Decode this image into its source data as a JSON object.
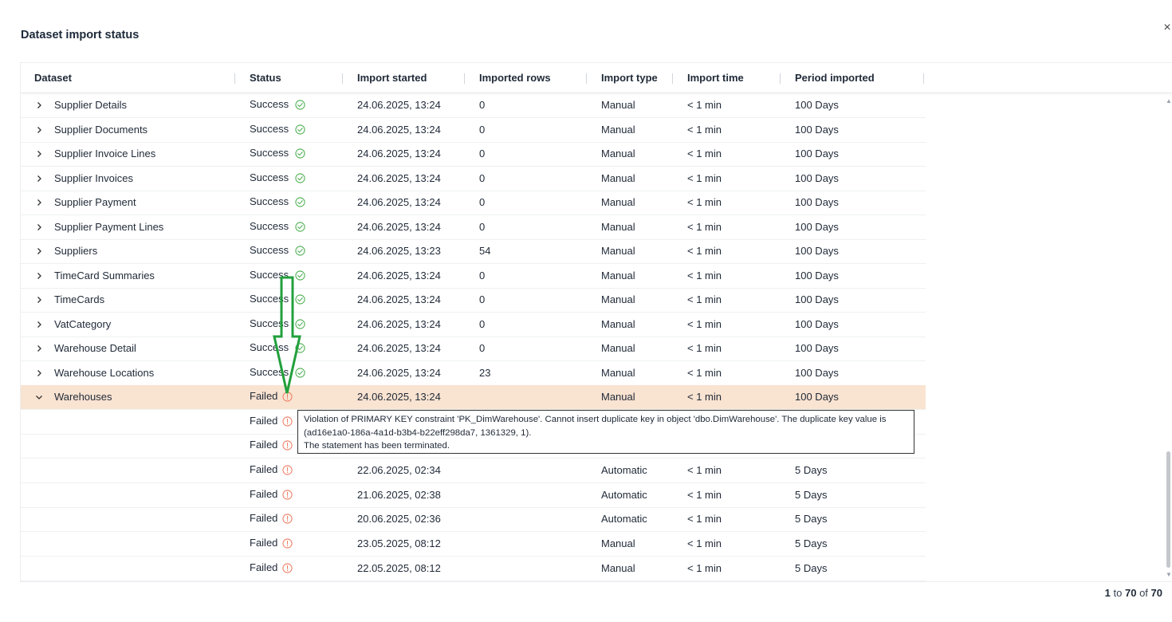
{
  "modal": {
    "title": "Dataset import status",
    "close_icon": "×"
  },
  "columns": [
    "Dataset",
    "Status",
    "Import started",
    "Imported rows",
    "Import type",
    "Import time",
    "Period imported"
  ],
  "rows": [
    {
      "dataset": "Supplier Details",
      "status": "Success",
      "started": "24.06.2025, 13:24",
      "rows": "0",
      "type": "Manual",
      "time": "< 1 min",
      "period": "100 Days"
    },
    {
      "dataset": "Supplier Documents",
      "status": "Success",
      "started": "24.06.2025, 13:24",
      "rows": "0",
      "type": "Manual",
      "time": "< 1 min",
      "period": "100 Days"
    },
    {
      "dataset": "Supplier Invoice Lines",
      "status": "Success",
      "started": "24.06.2025, 13:24",
      "rows": "0",
      "type": "Manual",
      "time": "< 1 min",
      "period": "100 Days"
    },
    {
      "dataset": "Supplier Invoices",
      "status": "Success",
      "started": "24.06.2025, 13:24",
      "rows": "0",
      "type": "Manual",
      "time": "< 1 min",
      "period": "100 Days"
    },
    {
      "dataset": "Supplier Payment",
      "status": "Success",
      "started": "24.06.2025, 13:24",
      "rows": "0",
      "type": "Manual",
      "time": "< 1 min",
      "period": "100 Days"
    },
    {
      "dataset": "Supplier Payment Lines",
      "status": "Success",
      "started": "24.06.2025, 13:24",
      "rows": "0",
      "type": "Manual",
      "time": "< 1 min",
      "period": "100 Days"
    },
    {
      "dataset": "Suppliers",
      "status": "Success",
      "started": "24.06.2025, 13:23",
      "rows": "54",
      "type": "Manual",
      "time": "< 1 min",
      "period": "100 Days"
    },
    {
      "dataset": "TimeCard Summaries",
      "status": "Success",
      "started": "24.06.2025, 13:24",
      "rows": "0",
      "type": "Manual",
      "time": "< 1 min",
      "period": "100 Days"
    },
    {
      "dataset": "TimeCards",
      "status": "Success",
      "started": "24.06.2025, 13:24",
      "rows": "0",
      "type": "Manual",
      "time": "< 1 min",
      "period": "100 Days"
    },
    {
      "dataset": "VatCategory",
      "status": "Success",
      "started": "24.06.2025, 13:24",
      "rows": "0",
      "type": "Manual",
      "time": "< 1 min",
      "period": "100 Days"
    },
    {
      "dataset": "Warehouse Detail",
      "status": "Success",
      "started": "24.06.2025, 13:24",
      "rows": "0",
      "type": "Manual",
      "time": "< 1 min",
      "period": "100 Days"
    },
    {
      "dataset": "Warehouse Locations",
      "status": "Success",
      "started": "24.06.2025, 13:24",
      "rows": "23",
      "type": "Manual",
      "time": "< 1 min",
      "period": "100 Days"
    },
    {
      "dataset": "Warehouses",
      "status": "Failed",
      "started": "24.06.2025, 13:24",
      "rows": "",
      "type": "Manual",
      "time": "< 1 min",
      "period": "100 Days",
      "expanded": true,
      "selected": true
    },
    {
      "dataset": "",
      "status": "Failed",
      "started": "",
      "rows": "",
      "type": "",
      "time": "",
      "period": "",
      "child": true
    },
    {
      "dataset": "",
      "status": "Failed",
      "started": "",
      "rows": "",
      "type": "",
      "time": "",
      "period": "",
      "child": true
    },
    {
      "dataset": "",
      "status": "Failed",
      "started": "22.06.2025, 02:34",
      "rows": "",
      "type": "Automatic",
      "time": "< 1 min",
      "period": "5 Days",
      "child": true
    },
    {
      "dataset": "",
      "status": "Failed",
      "started": "21.06.2025, 02:38",
      "rows": "",
      "type": "Automatic",
      "time": "< 1 min",
      "period": "5 Days",
      "child": true
    },
    {
      "dataset": "",
      "status": "Failed",
      "started": "20.06.2025, 02:36",
      "rows": "",
      "type": "Automatic",
      "time": "< 1 min",
      "period": "5 Days",
      "child": true
    },
    {
      "dataset": "",
      "status": "Failed",
      "started": "23.05.2025, 08:12",
      "rows": "",
      "type": "Manual",
      "time": "< 1 min",
      "period": "5 Days",
      "child": true
    },
    {
      "dataset": "",
      "status": "Failed",
      "started": "22.05.2025, 08:12",
      "rows": "",
      "type": "Manual",
      "time": "< 1 min",
      "period": "5 Days",
      "child": true
    }
  ],
  "tooltip": {
    "lines": [
      "Violation of PRIMARY KEY constraint 'PK_DimWarehouse'. Cannot insert duplicate key in object 'dbo.DimWarehouse'. The duplicate key value is",
      "(ad16e1a0-186a-4a1d-b3b4-b22eff298da7, 1361329, 1).",
      "The statement has been terminated."
    ]
  },
  "pagination": {
    "from": "1",
    "to_word": "to",
    "to": "70",
    "of_word": "of",
    "total": "70"
  },
  "colors": {
    "success": "#4caf50",
    "failed": "#ef7c62",
    "selected_row": "#f9e3d1",
    "annotation": "#22a03c"
  },
  "icons": {
    "success": "check-circle-icon",
    "failed": "alert-circle-icon",
    "collapsed": "chevron-right-icon",
    "expanded": "chevron-down-icon"
  }
}
